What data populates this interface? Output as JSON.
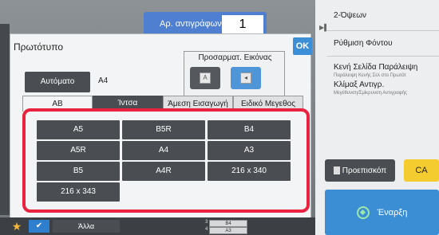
{
  "header": {
    "copies_label": "Αρ. αντιγράφων",
    "copies_value": "1"
  },
  "dialog": {
    "title": "Πρωτότυπο",
    "ok_label": "OK",
    "adjust_label": "Προσαρματ. Εικόνας",
    "auto_label": "Αυτόματο",
    "auto_size": "A4",
    "tabs": [
      "AB",
      "Ίντσα",
      "Άμεση Εισαγωγή",
      "Ειδικό Μεγεθος"
    ],
    "sizes": [
      "A5",
      "B5R",
      "B4",
      "A5R",
      "A4",
      "A3",
      "B5",
      "A4R",
      "216 x 340",
      "216 x 343"
    ]
  },
  "right_panel": {
    "duplex": "2-Όψεων",
    "background": "Ρύθμιση Φόντου",
    "blank_skip": "Κενή Σελίδα Παράλειψη",
    "blank_skip_sub": "Παράλειψη Κενής Σελ στο Πρωτότ",
    "copy_ratio": "Κλίμαξ Αντιγρ.",
    "copy_ratio_sub": "Μεγέθυνση/Σμίκρυνση Αντιγραφής",
    "preview": "Προεπισκόπ",
    "ca": "CA",
    "start": "Έναρξη"
  },
  "bottom": {
    "other": "Άλλα",
    "tray_b4": "B4",
    "tray_a3": "A3",
    "tray_3": "3",
    "tray_4": "4"
  },
  "colors": {
    "accent": "#3b8ed4",
    "highlight": "#e8223f",
    "ca": "#f4cc2f"
  }
}
